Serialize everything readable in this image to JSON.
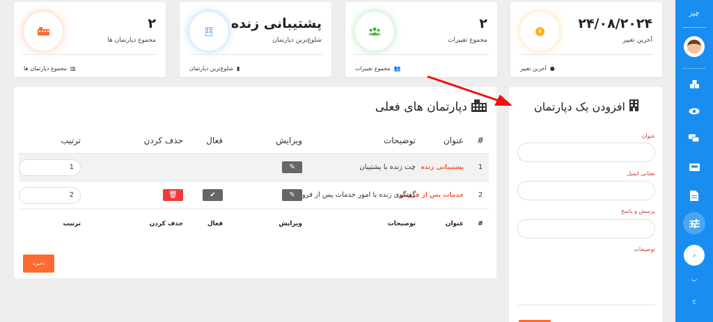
{
  "nav": {
    "brand": "چپز",
    "bottom_circle": "د",
    "letters": [
      "پ",
      "ج"
    ],
    "items": [
      "cubes-icon",
      "eye-icon",
      "comments-icon",
      "inbox-icon",
      "file-icon",
      "sliders-icon"
    ]
  },
  "stats": [
    {
      "value": "۲",
      "label": "مجموع دپارتمان ها",
      "footer": "مجموع دپارتمان ها",
      "icon": "building-icon",
      "color": "#ff6b35"
    },
    {
      "value": "پشتیبانی زنده",
      "label": "شلوغ‌ترین دپارتمان",
      "footer": "شلوغ‌ترین دپارتمان",
      "icon": "building-icon",
      "color": "#2d8ee8"
    },
    {
      "value": "۲",
      "label": "مجموع تغییرات",
      "footer": "مجموع تغییرات",
      "icon": "users-icon",
      "color": "#3cba3c"
    },
    {
      "value": "۲۴/۰۸/۲۰۲۴",
      "label": "آخرین تغییر",
      "footer": "آخرین تغییر",
      "icon": "clock-icon",
      "color": "#ffb020"
    }
  ],
  "departments": {
    "title": "دپارتمان های فعلی",
    "columns": {
      "num": "#",
      "title": "عنوان",
      "desc": "توضیحات",
      "edit": "ویرایش",
      "active": "فعال",
      "delete": "حذف کردن",
      "order": "ترتیب"
    },
    "rows": [
      {
        "num": "1",
        "title": "پشتیبانی زنده",
        "desc": "چت زنده با پشتیبان",
        "order": "1",
        "active": false
      },
      {
        "num": "2",
        "title": "خدمات پس از فروش",
        "desc": "گفتگوی زنده با امور خدمات پس از فروش",
        "order": "2",
        "active": true
      }
    ],
    "save_label": "ذخیره"
  },
  "add_form": {
    "title": "افزودن یک دپارتمان",
    "fields": {
      "title": "عنوان",
      "email": "نشانی ایمیل",
      "faq": "پرسش و پاسخ",
      "desc": "توضیحات"
    }
  }
}
